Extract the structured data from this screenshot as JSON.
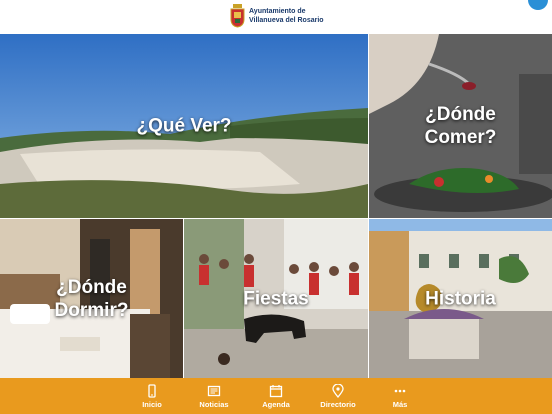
{
  "header": {
    "logo_line1": "Ayuntamiento de",
    "logo_line2": "Villanueva del Rosario"
  },
  "tiles": [
    {
      "label": "¿Qué Ver?"
    },
    {
      "label": "¿Dónde\nComer?"
    },
    {
      "label": "¿Dónde\nDormir?"
    },
    {
      "label": "Fiestas"
    },
    {
      "label": "Historia"
    }
  ],
  "nav": {
    "items": [
      {
        "label": "Inicio",
        "icon": "phone-icon"
      },
      {
        "label": "Noticias",
        "icon": "newspaper-icon"
      },
      {
        "label": "Agenda",
        "icon": "calendar-icon"
      },
      {
        "label": "Directorio",
        "icon": "location-pin-icon"
      },
      {
        "label": "Más",
        "icon": "more-dots-icon"
      }
    ]
  },
  "colors": {
    "nav_background": "#e99a1e",
    "logo_text": "#1a3a6b",
    "label_text": "#ffffff"
  }
}
